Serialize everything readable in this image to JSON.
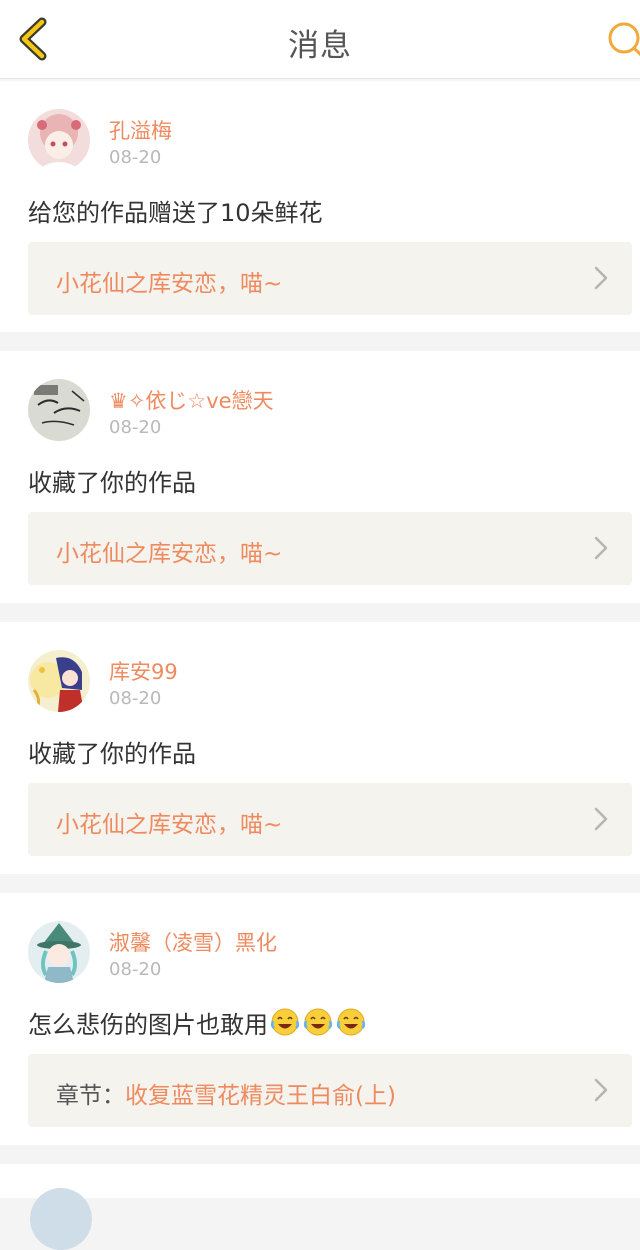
{
  "header": {
    "title": "消息",
    "back_icon": "chevron-left-icon",
    "search_icon": "search-icon",
    "accent_color": "#f2a93b"
  },
  "colors": {
    "username": "#ef8a5f",
    "date": "#b9b9b9",
    "link_bg": "#f4f3ee"
  },
  "messages": [
    {
      "username": "孔溢梅",
      "date": "08-20",
      "text": "给您的作品赠送了10朵鲜花",
      "work_prefix": "",
      "work_title": "小花仙之库安恋，喵~"
    },
    {
      "username": "♛✧依じ☆ve戀天",
      "date": "08-20",
      "text": "收藏了你的作品",
      "work_prefix": "",
      "work_title": "小花仙之库安恋，喵~"
    },
    {
      "username": "库安99",
      "date": "08-20",
      "text": "收藏了你的作品",
      "work_prefix": "",
      "work_title": "小花仙之库安恋，喵~"
    },
    {
      "username": "淑馨（凌雪）黑化",
      "date": "08-20",
      "text": "怎么悲伤的图片也敢用",
      "emoji": [
        "laughing-crying-emoji",
        "laughing-crying-emoji",
        "laughing-crying-emoji"
      ],
      "work_prefix": "章节：",
      "work_title": "收复蓝雪花精灵王白俞(上)"
    }
  ]
}
